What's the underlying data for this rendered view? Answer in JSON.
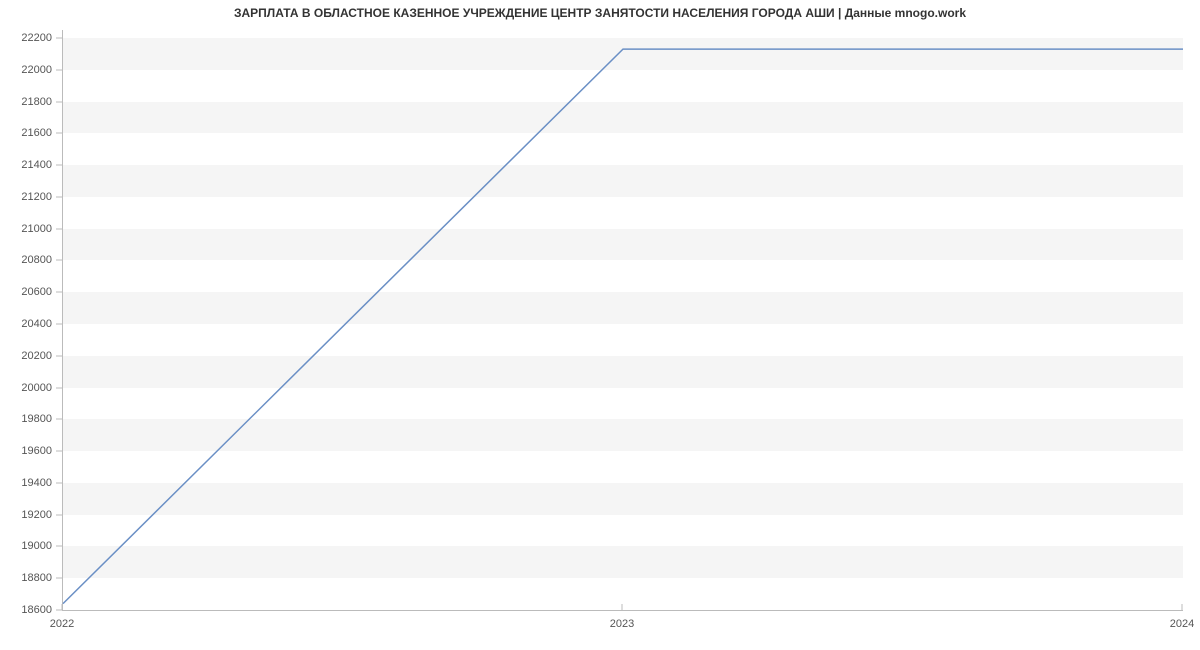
{
  "chart_data": {
    "type": "line",
    "title": "ЗАРПЛАТА В ОБЛАСТНОЕ КАЗЕННОЕ УЧРЕЖДЕНИЕ ЦЕНТР ЗАНЯТОСТИ НАСЕЛЕНИЯ ГОРОДА АШИ | Данные mnogo.work",
    "xlabel": "",
    "ylabel": "",
    "x": [
      2022,
      2023,
      2024
    ],
    "x_tick_labels": [
      "2022",
      "2023",
      "2024"
    ],
    "values": [
      18640,
      22130,
      22130
    ],
    "y_ticks": [
      18600,
      18800,
      19000,
      19200,
      19400,
      19600,
      19800,
      20000,
      20200,
      20400,
      20600,
      20800,
      21000,
      21200,
      21400,
      21600,
      21800,
      22000,
      22200
    ],
    "ylim": [
      18600,
      22250
    ],
    "xlim": [
      2022,
      2024
    ]
  }
}
